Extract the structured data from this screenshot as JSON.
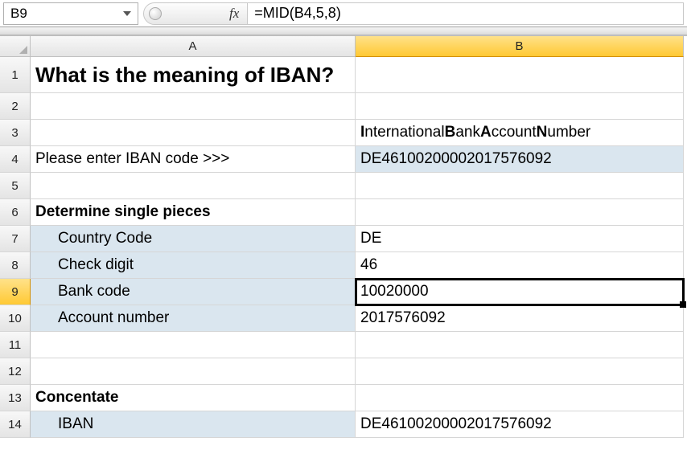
{
  "formula_bar": {
    "cell_ref": "B9",
    "fx_label": "fx",
    "formula": "=MID(B4,5,8)"
  },
  "columns": {
    "A": "A",
    "B": "B"
  },
  "row_labels": [
    "1",
    "2",
    "3",
    "4",
    "5",
    "6",
    "7",
    "8",
    "9",
    "10",
    "11",
    "12",
    "13",
    "14"
  ],
  "cells": {
    "A1": "What is the meaning of IBAN?",
    "B3_parts": {
      "I": "I",
      "nternational": "nternational ",
      "B": "B",
      "ank": "ank ",
      "A": "A",
      "ccount": "ccount ",
      "N": "N",
      "umber": "umber"
    },
    "A4": "Please enter IBAN code >>>",
    "B4": "DE4610020000­2017576092",
    "B4_plain": "DE46100200002017576092",
    "A6": "Determine single pieces",
    "A7": "Country Code",
    "B7": "DE",
    "A8": "Check digit",
    "B8": "46",
    "A9": "Bank code",
    "B9": "10020000",
    "A10": "Account number",
    "B10": "2017576092",
    "A13": "Concentate",
    "A14": "IBAN",
    "B14": "DE46100200002017576092"
  }
}
